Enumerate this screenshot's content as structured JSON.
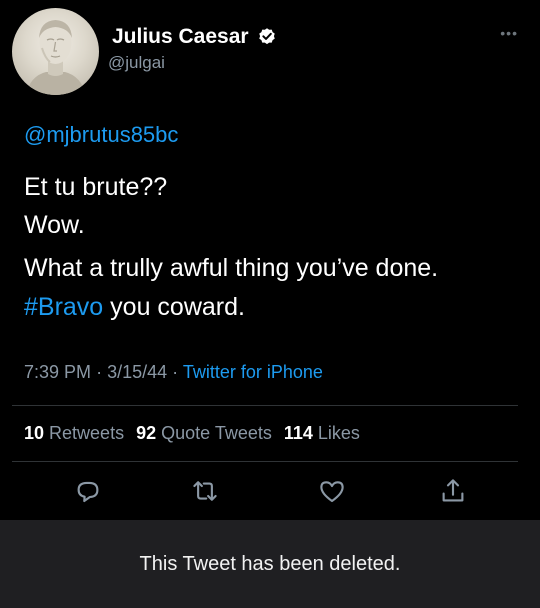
{
  "user": {
    "display_name": "Julius Caesar",
    "handle": "@julgai",
    "verified": true
  },
  "tweet": {
    "mention": "@mjbrutus85bc",
    "line1": "Et tu brute??",
    "line2": "Wow.",
    "line3": "What a trully awful thing you’ve done.",
    "hashtag": "#Bravo",
    "line4_rest": " you coward.",
    "time": "7:39 PM",
    "date": "3/15/44",
    "separator": "·",
    "source": "Twitter for iPhone"
  },
  "stats": {
    "retweets_count": "10",
    "retweets_label": " Retweets",
    "quotes_count": "92",
    "quotes_label": " Quote Tweets",
    "likes_count": "114",
    "likes_label": " Likes"
  },
  "actions": {
    "icons": [
      "reply-icon",
      "retweet-icon",
      "like-icon",
      "share-icon"
    ]
  },
  "banner": {
    "text": "This Tweet has been deleted."
  },
  "colors": {
    "background": "#000000",
    "link": "#1d9bf0",
    "secondary_text": "#8b98a5",
    "banner_bg": "#1f1f22"
  }
}
